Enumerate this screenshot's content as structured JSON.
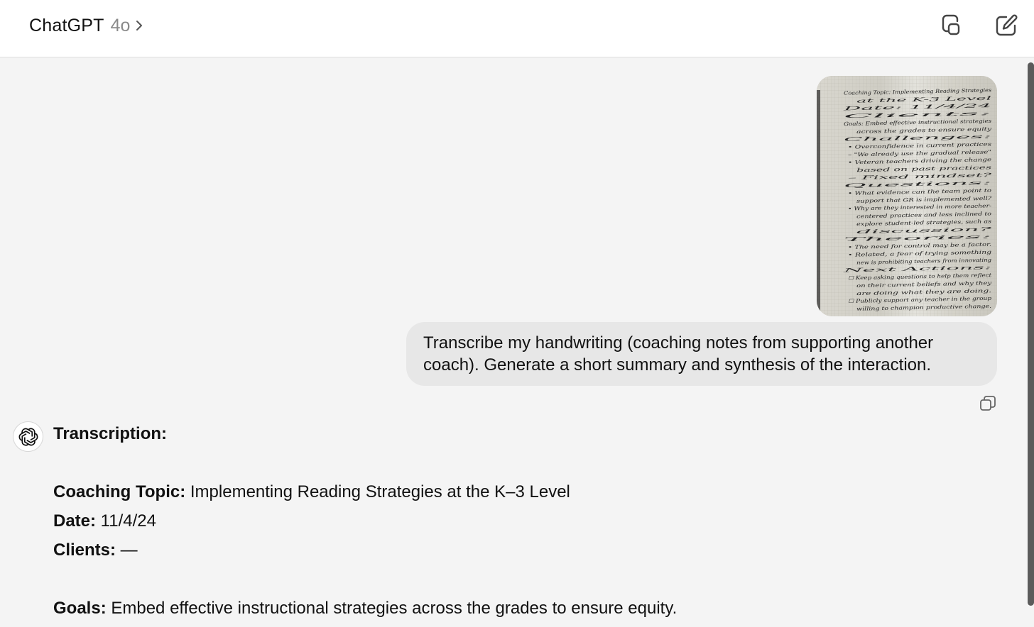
{
  "header": {
    "app_name": "ChatGPT",
    "model": "4o",
    "icons": [
      "chevron-right-icon",
      "new-window-icon",
      "compose-icon"
    ]
  },
  "conversation": {
    "user_image": {
      "alt": "Handwritten coaching notes on graph paper",
      "handwriting": [
        "Coaching Topic: Implementing Reading Strategies",
        "at the K-3 Level",
        "Date: 11/4/24",
        "Clients:",
        "Goals: Embed effective instructional strategies",
        "across the grades to ensure equity",
        "Challenges:",
        "• Overconfidence in current practices",
        "– \"We already use the gradual release\"",
        "• Veteran teachers driving the change",
        "based on past practices",
        "– Fixed mindset?",
        "Questions:",
        "• What evidence can the team point to",
        "support that GR is implemented well?",
        "• Why are they interested in more teacher-",
        "centered practices and less inclined to",
        "explore student-led strategies, such as",
        "discussion?",
        "Theories:",
        "• The need for control may be a factor.",
        "• Related, a fear of trying something",
        "new is prohibiting teachers from innovating",
        "Next Actions:",
        "☐ Keep asking questions to help them reflect",
        "on their current beliefs and why they",
        "are doing what they are doing.",
        "☐ Publicly support any teacher in the group",
        "willing to champion productive change."
      ]
    },
    "user_message": {
      "line1": "Transcribe my handwriting (coaching notes from supporting another",
      "line2": "coach). Generate a short summary and synthesis of the interaction."
    },
    "assistant": {
      "heading": "Transcription:",
      "fields": [
        {
          "label": "Coaching Topic:",
          "value": " Implementing Reading Strategies at the K–3 Level"
        },
        {
          "label": "Date:",
          "value": " 11/4/24"
        },
        {
          "label": "Clients:",
          "value": " —"
        },
        {
          "label": "Goals:",
          "value": " Embed effective instructional strategies across the grades to ensure equity."
        }
      ]
    }
  },
  "colors": {
    "page_bg": "#f4f4f4",
    "header_bg": "#ffffff",
    "user_bubble_bg": "#e7e7e7",
    "model_text": "#8a8a8a",
    "scrollbar": "#5b5b5b"
  }
}
